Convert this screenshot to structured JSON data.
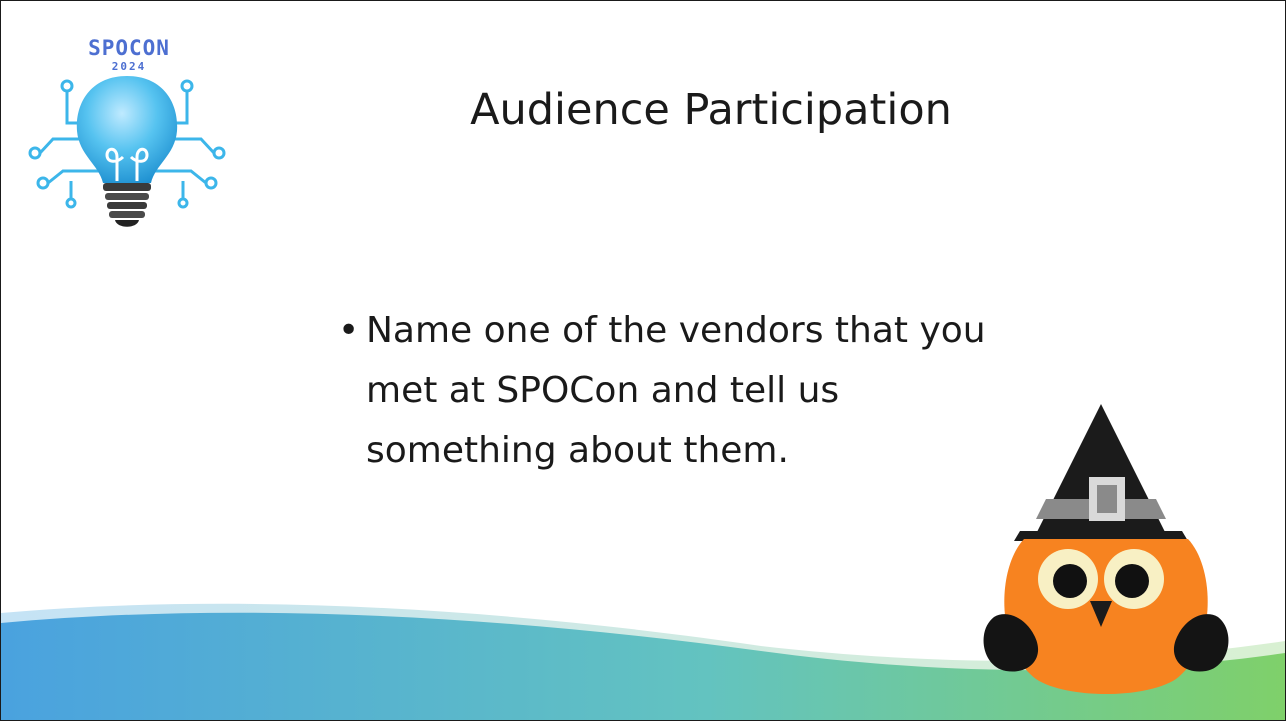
{
  "logo": {
    "name": "SPOCON",
    "year": "2024"
  },
  "slide": {
    "title": "Audience Participation",
    "bullets": [
      "Name one of the vendors that you met at SPOCon and tell us something about them."
    ]
  },
  "colors": {
    "logo_blue": "#4d6fd1",
    "bulb_blue": "#3cb6ea",
    "wave_start": "#4aa2df",
    "wave_end": "#7fd06a",
    "owl_orange": "#f78320"
  },
  "icons": [
    "lightbulb-circuit-logo",
    "owl-witch-hat-illustration"
  ]
}
